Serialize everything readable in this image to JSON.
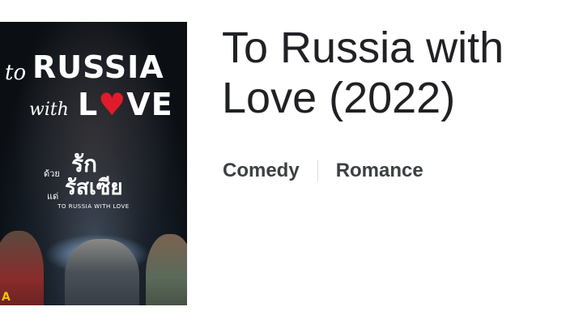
{
  "poster": {
    "title_to": "to",
    "title_russia": "RUSSIA",
    "title_with": "with",
    "title_love_prefix": "L",
    "title_love_heart": "♥",
    "title_love_suffix": "VE",
    "thai_small_1": "ด้วย",
    "thai_big_1": "รัก",
    "thai_small_2": "แด่",
    "thai_big_2": "รัสเซีย",
    "subtitle": "TO RUSSIA WITH LOVE",
    "corner_badge": "A",
    "accent_color": "#e01b2b"
  },
  "movie": {
    "title": "To Russia with Love (2022)",
    "genres": [
      "Comedy",
      "Romance"
    ]
  }
}
